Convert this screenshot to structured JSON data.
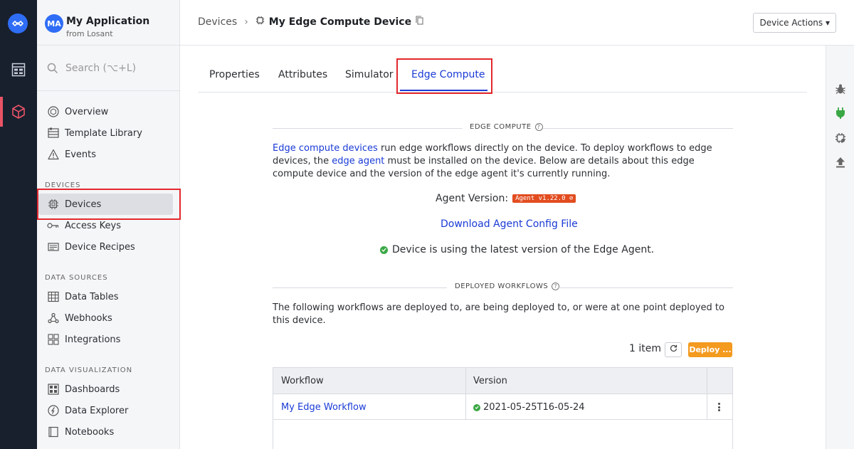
{
  "app": {
    "avatar": "MA",
    "name": "My Application",
    "sub": "from Losant"
  },
  "search": {
    "placeholder": "Search (⌥+L)"
  },
  "sidebar": {
    "top_items": [
      {
        "label": "Overview",
        "icon": "cube-circle-icon"
      },
      {
        "label": "Template Library",
        "icon": "template-library-icon"
      },
      {
        "label": "Events",
        "icon": "warning-icon"
      }
    ],
    "sections": [
      {
        "label": "DEVICES",
        "items": [
          {
            "label": "Devices",
            "icon": "chip-icon",
            "active": true
          },
          {
            "label": "Access Keys",
            "icon": "key-icon"
          },
          {
            "label": "Device Recipes",
            "icon": "recipe-icon"
          }
        ]
      },
      {
        "label": "DATA SOURCES",
        "items": [
          {
            "label": "Data Tables",
            "icon": "table-icon"
          },
          {
            "label": "Webhooks",
            "icon": "webhook-icon"
          },
          {
            "label": "Integrations",
            "icon": "integrations-icon"
          }
        ]
      },
      {
        "label": "DATA VISUALIZATION",
        "items": [
          {
            "label": "Dashboards",
            "icon": "dashboard-icon"
          },
          {
            "label": "Data Explorer",
            "icon": "data-explorer-icon"
          },
          {
            "label": "Notebooks",
            "icon": "notebook-icon"
          }
        ]
      }
    ]
  },
  "header": {
    "breadcrumb_root": "Devices",
    "separator": "›",
    "device_name": "My Edge Compute Device",
    "actions_label": "Device Actions ▾"
  },
  "tabs": [
    {
      "label": "Properties"
    },
    {
      "label": "Attributes"
    },
    {
      "label": "Simulator"
    },
    {
      "label": "Edge Compute",
      "active": true
    }
  ],
  "edge": {
    "section_title": "EDGE COMPUTE",
    "intro_link1": "Edge compute devices",
    "intro_text1": " run edge workflows directly on the device. To deploy workflows to edge devices, the ",
    "intro_link2": "edge agent",
    "intro_text2": " must be installed on the device. Below are details about this edge compute device and the version of the edge agent it's currently running.",
    "agent_version_label": "Agent Version:",
    "agent_badge": "Agent v1.22.0 ⊘",
    "download_link": "Download Agent Config File",
    "status_text": "Device is using the latest version of the Edge Agent."
  },
  "deployed": {
    "section_title": "DEPLOYED WORKFLOWS",
    "description": "The following workflows are deployed to, are being deployed to, or were at one point deployed to this device.",
    "count": "1 item",
    "deploy_label": "Deploy ...",
    "columns": [
      "Workflow",
      "Version"
    ],
    "rows": [
      {
        "workflow": "My Edge Workflow",
        "version": "2021-05-25T16-05-24"
      }
    ]
  },
  "colors": {
    "accent": "#1a3bd6",
    "highlight": "#e3282d",
    "deploy": "#f39a1f",
    "ok": "#3aa845",
    "badge": "#e24c1f"
  }
}
